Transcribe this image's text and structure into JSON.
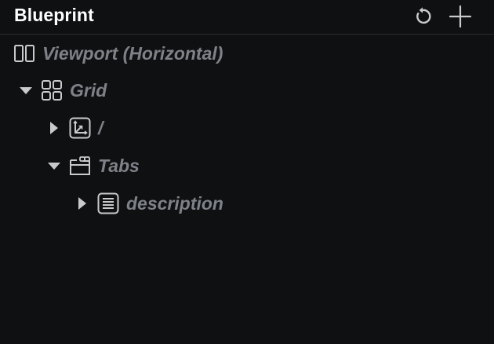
{
  "panel": {
    "title": "Blueprint",
    "actions": [
      {
        "name": "reset",
        "icon": "reset-icon"
      },
      {
        "name": "add",
        "icon": "plus-icon"
      }
    ]
  },
  "tree": {
    "viewport": {
      "label": "Viewport (Horizontal)",
      "icon": "viewport-horizontal-icon"
    },
    "grid": {
      "label": "Grid",
      "icon": "grid-icon",
      "expanded": true
    },
    "root_view": {
      "label": "/",
      "icon": "spatial-2d-view-icon",
      "expanded": false
    },
    "tabs": {
      "label": "Tabs",
      "icon": "tabs-container-icon",
      "expanded": true
    },
    "description": {
      "label": "description",
      "icon": "text-document-icon",
      "expanded": false
    }
  },
  "colors": {
    "background": "#0f1012",
    "title": "#ffffff",
    "label": "#7e8288",
    "icon": "#c8cacd",
    "divider": "#2a2c30"
  }
}
